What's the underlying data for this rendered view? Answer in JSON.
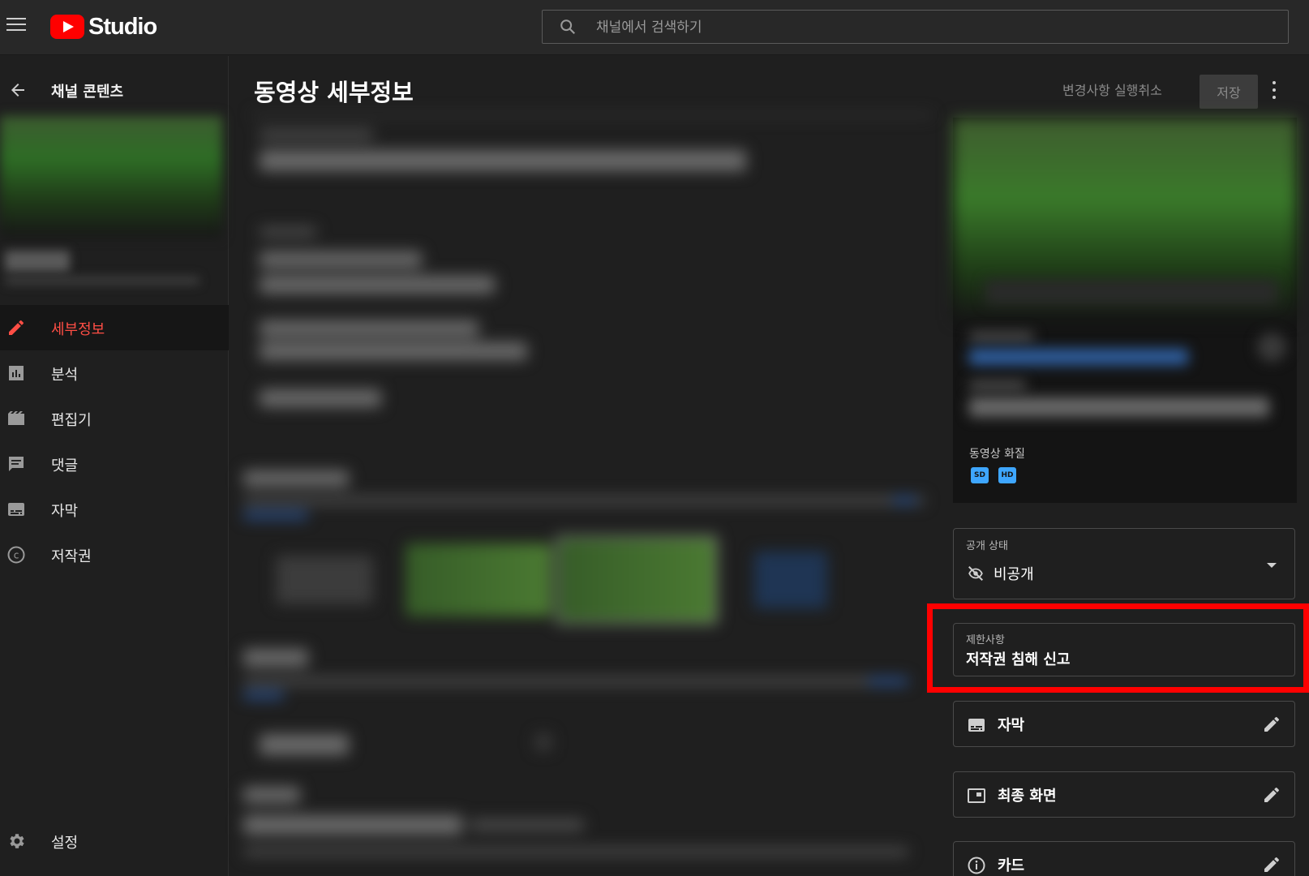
{
  "header": {
    "brand": "Studio",
    "search_placeholder": "채널에서 검색하기"
  },
  "sidebar": {
    "back_label": "채널 콘텐츠",
    "items": [
      {
        "label": "세부정보",
        "icon": "pencil-icon",
        "active": true
      },
      {
        "label": "분석",
        "icon": "analytics-icon",
        "active": false
      },
      {
        "label": "편집기",
        "icon": "editor-icon",
        "active": false
      },
      {
        "label": "댓글",
        "icon": "comments-icon",
        "active": false
      },
      {
        "label": "자막",
        "icon": "subtitles-icon",
        "active": false
      },
      {
        "label": "저작권",
        "icon": "copyright-icon",
        "active": false
      }
    ],
    "settings_label": "설정"
  },
  "main": {
    "title": "동영상 세부정보",
    "undo_label": "변경사항 실행취소",
    "save_label": "저장"
  },
  "right_panel": {
    "video_quality_label": "동영상 화질",
    "quality_badges": [
      "SD",
      "HD"
    ],
    "visibility": {
      "label": "공개 상태",
      "value": "비공개"
    },
    "restrictions": {
      "label": "제한사항",
      "value": "저작권 침해 신고"
    },
    "tools": [
      {
        "label": "자막",
        "icon": "subtitles-icon"
      },
      {
        "label": "최종 화면",
        "icon": "end-screen-icon"
      },
      {
        "label": "카드",
        "icon": "info-icon"
      }
    ]
  },
  "colors": {
    "accent_active": "#ff4e45",
    "highlight_box": "#ff0000",
    "quality_badge": "#3ea6ff"
  }
}
